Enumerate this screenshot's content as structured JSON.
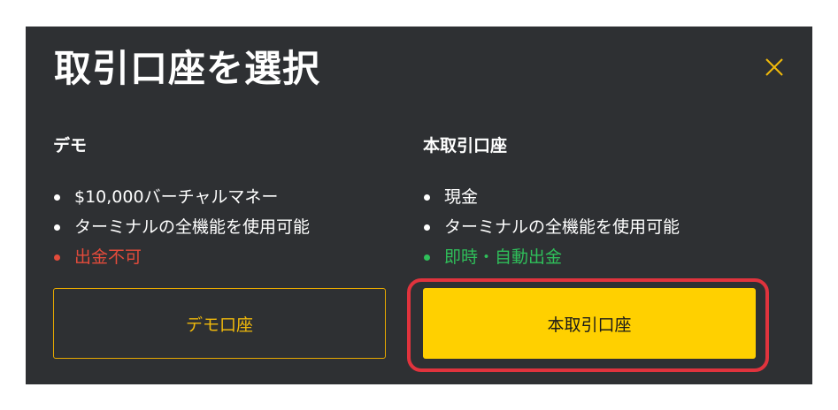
{
  "dialog": {
    "title": "取引口座を選択",
    "close_icon": "close-icon",
    "accent_color": "#ffd000"
  },
  "accounts": [
    {
      "heading": "デモ",
      "features": [
        {
          "text": "$10,000バーチャルマネー",
          "color": "#ffffff"
        },
        {
          "text": "ターミナルの全機能を使用可能",
          "color": "#ffffff"
        },
        {
          "text": "出金不可",
          "color": "#e34b3b"
        }
      ],
      "button_label": "デモ口座"
    },
    {
      "heading": "本取引口座",
      "features": [
        {
          "text": "現金",
          "color": "#ffffff"
        },
        {
          "text": "ターミナルの全機能を使用可能",
          "color": "#ffffff"
        },
        {
          "text": "即時・自動出金",
          "color": "#2fbf5a"
        }
      ],
      "button_label": "本取引口座"
    }
  ],
  "annotation": {
    "highlight_color": "#e0333d"
  }
}
